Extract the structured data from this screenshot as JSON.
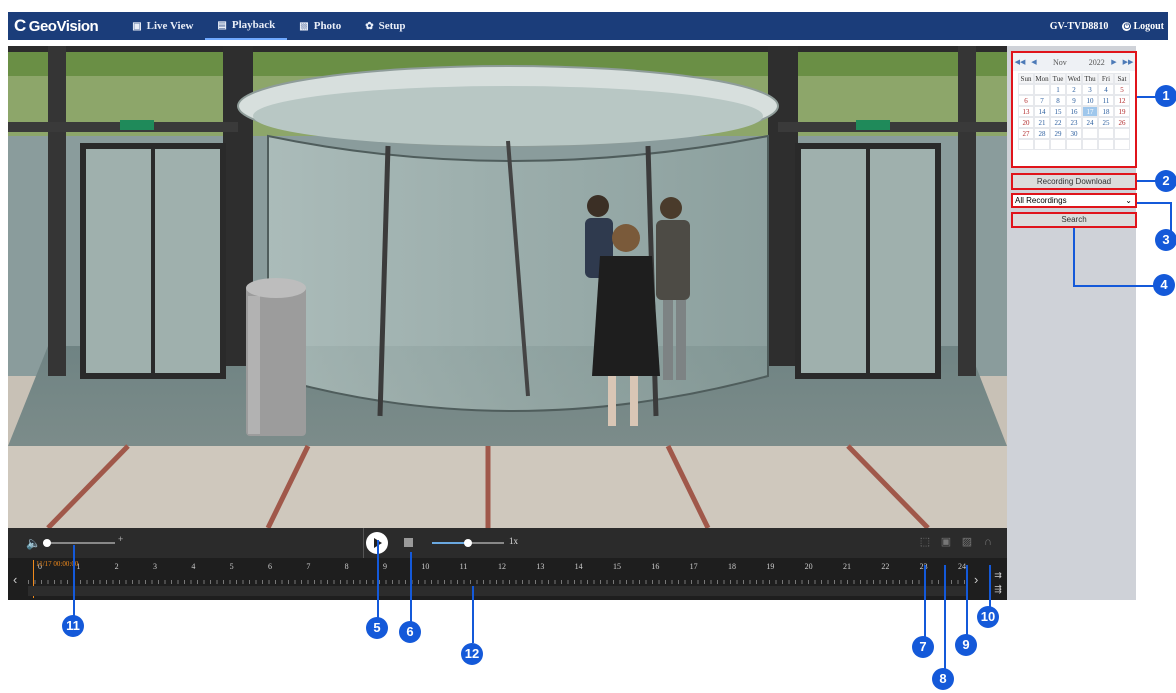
{
  "app": {
    "brand": "GeoVision",
    "brand_mark": "C"
  },
  "nav": {
    "items": [
      {
        "label": "Live View",
        "icon": "monitor-icon",
        "glyph": "▣"
      },
      {
        "label": "Playback",
        "icon": "film-icon",
        "glyph": "▤"
      },
      {
        "label": "Photo",
        "icon": "image-icon",
        "glyph": "▧"
      },
      {
        "label": "Setup",
        "icon": "gear-icon",
        "glyph": "✿"
      }
    ],
    "active": "Playback",
    "device": "GV-TVD8810",
    "logout": "Logout"
  },
  "calendar": {
    "month": "Nov",
    "year": "2022",
    "prev_year": "◀◀",
    "prev_month": "◀",
    "next_month": "▶",
    "next_year": "▶▶",
    "weekdays": [
      "Sun",
      "Mon",
      "Tue",
      "Wed",
      "Thu",
      "Fri",
      "Sat"
    ],
    "weeks": [
      [
        "",
        "",
        "1",
        "2",
        "3",
        "4",
        "5"
      ],
      [
        "6",
        "7",
        "8",
        "9",
        "10",
        "11",
        "12"
      ],
      [
        "13",
        "14",
        "15",
        "16",
        "17",
        "18",
        "19"
      ],
      [
        "20",
        "21",
        "22",
        "23",
        "24",
        "25",
        "26"
      ],
      [
        "27",
        "28",
        "29",
        "30",
        "",
        "",
        ""
      ],
      [
        "",
        "",
        "",
        "",
        "",
        "",
        ""
      ]
    ],
    "selected_day": "17"
  },
  "panel": {
    "download_label": "Recording Download",
    "filter_value": "All Recordings",
    "search_label": "Search"
  },
  "controls": {
    "volume_icon": "speaker-icon",
    "volume_level": 0.05,
    "speed_label": "1x",
    "speed_level": 0.5,
    "plus": "+"
  },
  "timeline": {
    "cursor_time": "11/17 00:00:00",
    "hours": [
      "0",
      "1",
      "2",
      "3",
      "4",
      "5",
      "6",
      "7",
      "8",
      "9",
      "10",
      "11",
      "12",
      "13",
      "14",
      "15",
      "16",
      "17",
      "18",
      "19",
      "20",
      "21",
      "22",
      "23",
      "24"
    ],
    "prev": "‹",
    "next": "›",
    "zoom_in": "⇉",
    "zoom_out": "⇶"
  },
  "callouts": [
    "1",
    "2",
    "3",
    "4",
    "5",
    "6",
    "7",
    "8",
    "9",
    "10",
    "11",
    "12"
  ],
  "colors": {
    "nav_bg": "#1b3d7a",
    "callout": "#1459d9",
    "highlight": "#e0141b",
    "timeline_cursor": "#f08a1c"
  }
}
